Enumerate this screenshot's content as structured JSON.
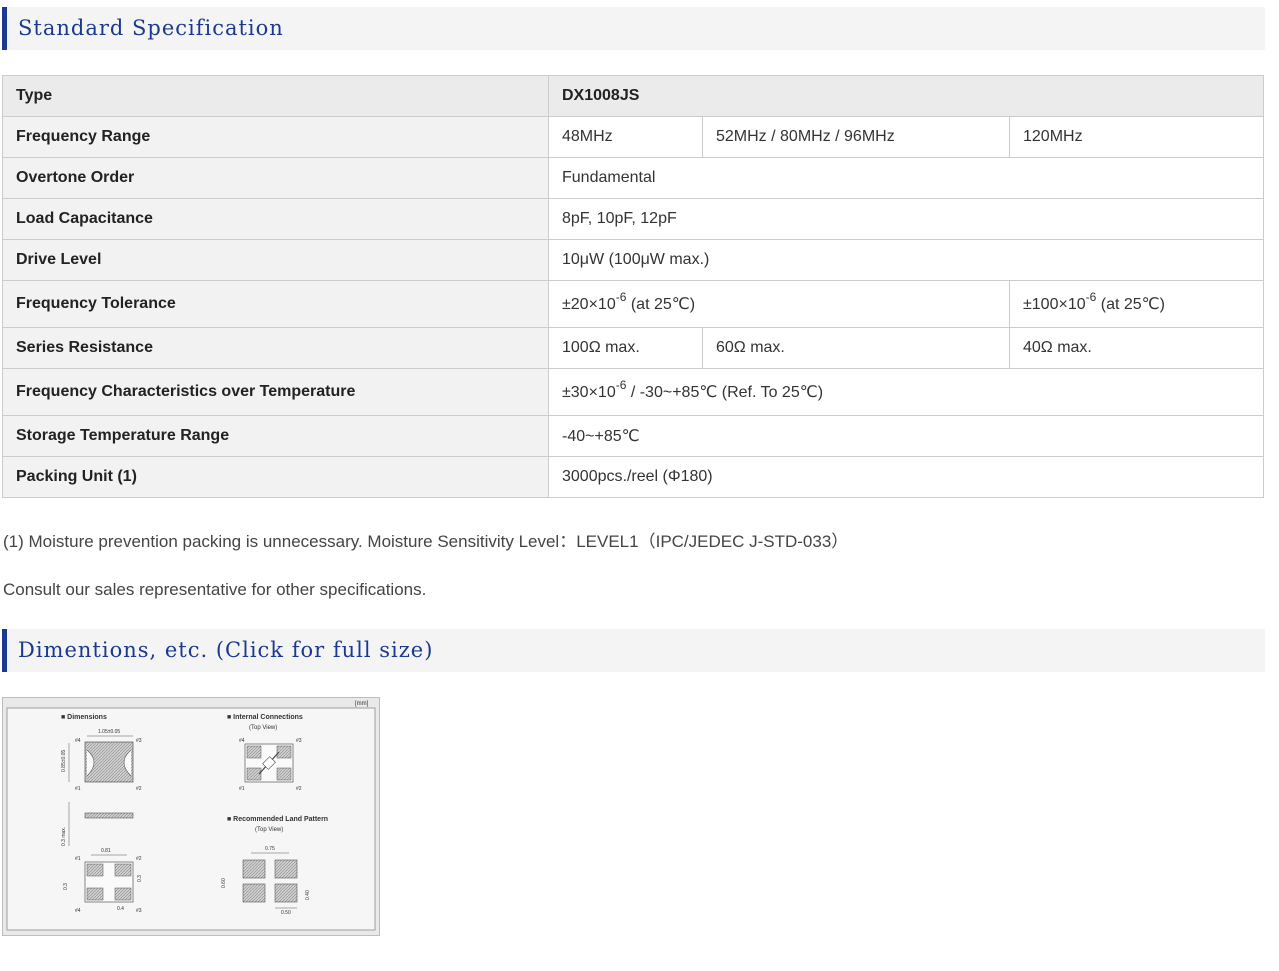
{
  "spec_section": {
    "title": "Standard Specification"
  },
  "table": {
    "type": {
      "label": "Type",
      "value": "DX1008JS"
    },
    "frequency_range": {
      "label": "Frequency Range",
      "v1": "48MHz",
      "v2": "52MHz / 80MHz / 96MHz",
      "v3": "120MHz"
    },
    "overtone_order": {
      "label": "Overtone Order",
      "value": "Fundamental"
    },
    "load_capacitance": {
      "label": "Load Capacitance",
      "value": "8pF, 10pF, 12pF"
    },
    "drive_level": {
      "label": "Drive Level",
      "value": "10μW (100μW max.)"
    },
    "frequency_tolerance": {
      "label": "Frequency Tolerance",
      "v1_base": "±20×10",
      "v1_exp": "-6",
      "v1_tail": " (at 25℃)",
      "v3_base": "±100×10",
      "v3_exp": "-6",
      "v3_tail": " (at 25℃)"
    },
    "series_resistance": {
      "label": "Series Resistance",
      "v1": "100Ω max.",
      "v2": "60Ω max.",
      "v3": "40Ω max."
    },
    "freq_char_temp": {
      "label": "Frequency Characteristics over Temperature",
      "base": "±30×10",
      "exp": "-6",
      "tail": " / -30~+85℃ (Ref. To 25℃)"
    },
    "storage_temp": {
      "label": "Storage Temperature Range",
      "value": "-40~+85℃"
    },
    "packing_unit": {
      "label": "Packing Unit (1)",
      "value": "3000pcs./reel (Φ180)"
    }
  },
  "notes": {
    "note1": "(1) Moisture prevention packing is unnecessary. Moisture Sensitivity Level：LEVEL1（IPC/JEDEC J-STD-033）",
    "note2": "Consult our sales representative for other specifications."
  },
  "dimension_section": {
    "title": "Dimentions, etc. (Click for full size)"
  },
  "drawing": {
    "unit": "[mm]",
    "dimensions_title": "■ Dimensions",
    "internal_title": "■ Internal Connections",
    "internal_view": "(Top View)",
    "land_title": "■ Recommended Land Pattern",
    "land_view": "(Top View)",
    "dim_width": "1.05±0.05",
    "dim_height": "0.85±0.05",
    "dim_thickness": "0.3 max.",
    "dim_pad_pitch": "0.81",
    "dim_pad_w": "0.4",
    "dim_pad_h": "0.3",
    "dim_pad_side": "0.3",
    "land_pitch_x": "0.75",
    "land_pitch_y": "0.60",
    "land_pad_w": "0.50",
    "land_pad_h": "0.40",
    "pin1": "#1",
    "pin2": "#2",
    "pin3": "#3",
    "pin4": "#4"
  }
}
